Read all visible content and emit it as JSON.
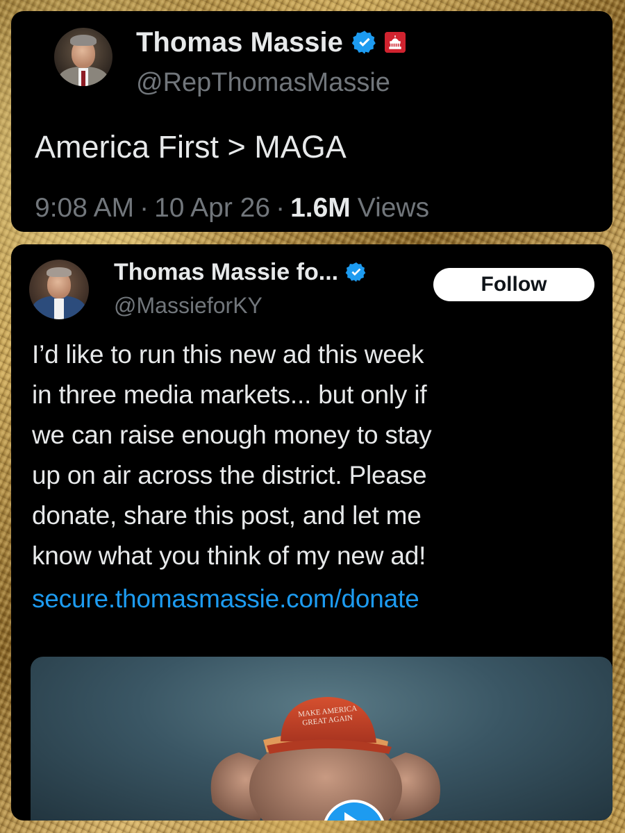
{
  "tweet_quoted": {
    "name": "Thomas Massie",
    "handle": "@RepThomasMassie",
    "text": "America First > MAGA",
    "time": "9:08 AM",
    "date": "10 Apr 26",
    "views_count": "1.6M",
    "views_label": "Views",
    "separator": "·"
  },
  "tweet_main": {
    "name": "Thomas Massie fo...",
    "handle": "@MassieforKY",
    "follow_label": "Follow",
    "body_lines": [
      "I’d like to run this new ad this week",
      "in three media markets... but only if",
      "we can raise enough money to stay",
      "up on air across the district. Please",
      "donate, share this post, and let me",
      "know what you think of my new ad!"
    ],
    "link": "secure.thomasmassie.com/donate",
    "media_hat_text_line1": "MAKE AMERICA",
    "media_hat_text_line2": "GREAT AGAIN"
  },
  "colors": {
    "card_bg": "#000000",
    "primary_text": "#e7e9ea",
    "secondary_text": "#71767b",
    "link": "#1d9bf0",
    "verified": "#1d9bf0",
    "gop_badge": "#d0232f",
    "hat_red": "#c2422b"
  },
  "icons": [
    "verified-badge-icon",
    "gop-capitol-icon",
    "play-icon"
  ]
}
